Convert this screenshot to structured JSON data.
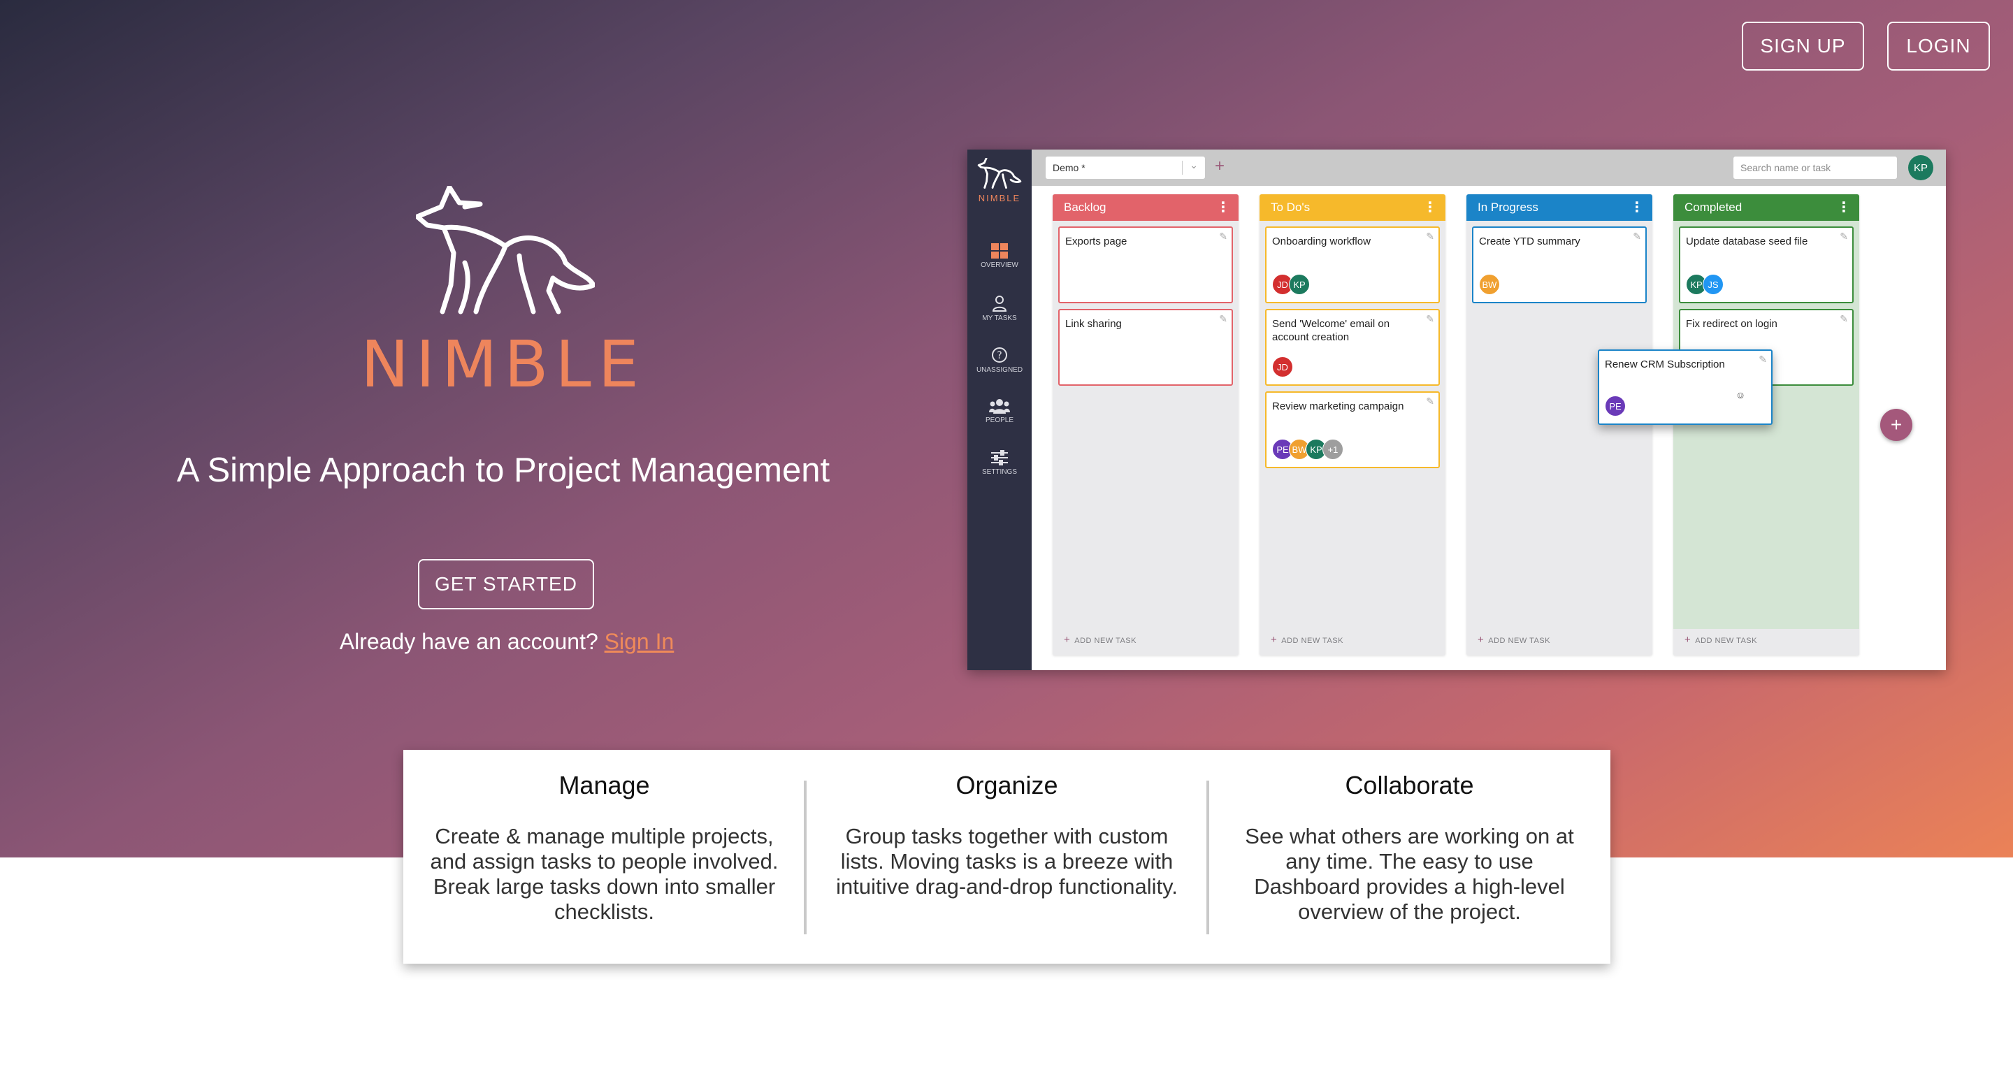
{
  "header": {
    "signup_label": "SIGN UP",
    "login_label": "LOGIN"
  },
  "hero": {
    "brand": "NIMBLE",
    "tagline": "A Simple Approach to Project Management",
    "cta_label": "GET STARTED",
    "account_prompt": "Already have an account?",
    "signin_link": "Sign In"
  },
  "preview": {
    "logo_text": "NIMBLE",
    "nav": [
      {
        "label": "OVERVIEW",
        "icon": "grid-icon"
      },
      {
        "label": "MY TASKS",
        "icon": "person-icon"
      },
      {
        "label": "UNASSIGNED",
        "icon": "question-icon"
      },
      {
        "label": "PEOPLE",
        "icon": "people-icon"
      },
      {
        "label": "SETTINGS",
        "icon": "sliders-icon"
      }
    ],
    "project_select": "Demo *",
    "search_placeholder": "Search name or task",
    "user_initials": "KP",
    "add_task_label": "ADD NEW TASK",
    "columns": [
      {
        "title": "Backlog",
        "color": "#e2636a",
        "cards": [
          {
            "title": "Exports page",
            "avatars": []
          },
          {
            "title": "Link sharing",
            "avatars": []
          }
        ]
      },
      {
        "title": "To Do's",
        "color": "#f6b92b",
        "cards": [
          {
            "title": "Onboarding workflow",
            "avatars": [
              {
                "i": "JD",
                "c": "#d32f2f"
              },
              {
                "i": "KP",
                "c": "#1c7a5e"
              }
            ]
          },
          {
            "title": "Send 'Welcome' email on account creation",
            "avatars": [
              {
                "i": "JD",
                "c": "#d32f2f"
              }
            ]
          },
          {
            "title": "Review marketing campaign",
            "avatars": [
              {
                "i": "PE",
                "c": "#6a3ab8"
              },
              {
                "i": "BW",
                "c": "#f0a030"
              },
              {
                "i": "KP",
                "c": "#1c7a5e"
              },
              {
                "i": "+1",
                "c": "#9e9e9e"
              }
            ]
          }
        ]
      },
      {
        "title": "In Progress",
        "color": "#1b84c8",
        "cards": [
          {
            "title": "Create YTD summary",
            "avatars": [
              {
                "i": "BW",
                "c": "#f0a030"
              }
            ]
          }
        ]
      },
      {
        "title": "Completed",
        "color": "#3c8d3c",
        "cards": [
          {
            "title": "Update database seed file",
            "avatars": [
              {
                "i": "KP",
                "c": "#1c7a5e"
              },
              {
                "i": "JS",
                "c": "#2196f3"
              }
            ]
          },
          {
            "title": "Fix redirect on login",
            "avatars": []
          }
        ]
      }
    ],
    "dragging_card": {
      "title": "Renew CRM Subscription",
      "avatar": "PE",
      "avatar_color": "#6a3ab8"
    }
  },
  "features": [
    {
      "title": "Manage",
      "text": "Create & manage multiple projects, and assign tasks to people involved. Break large tasks down into smaller checklists."
    },
    {
      "title": "Organize",
      "text": "Group tasks together with custom lists. Moving tasks is a breeze with intuitive drag-and-drop functionality."
    },
    {
      "title": "Collaborate",
      "text": "See what others are working on at any time. The easy to use Dashboard provides a high-level overview of the project."
    }
  ]
}
